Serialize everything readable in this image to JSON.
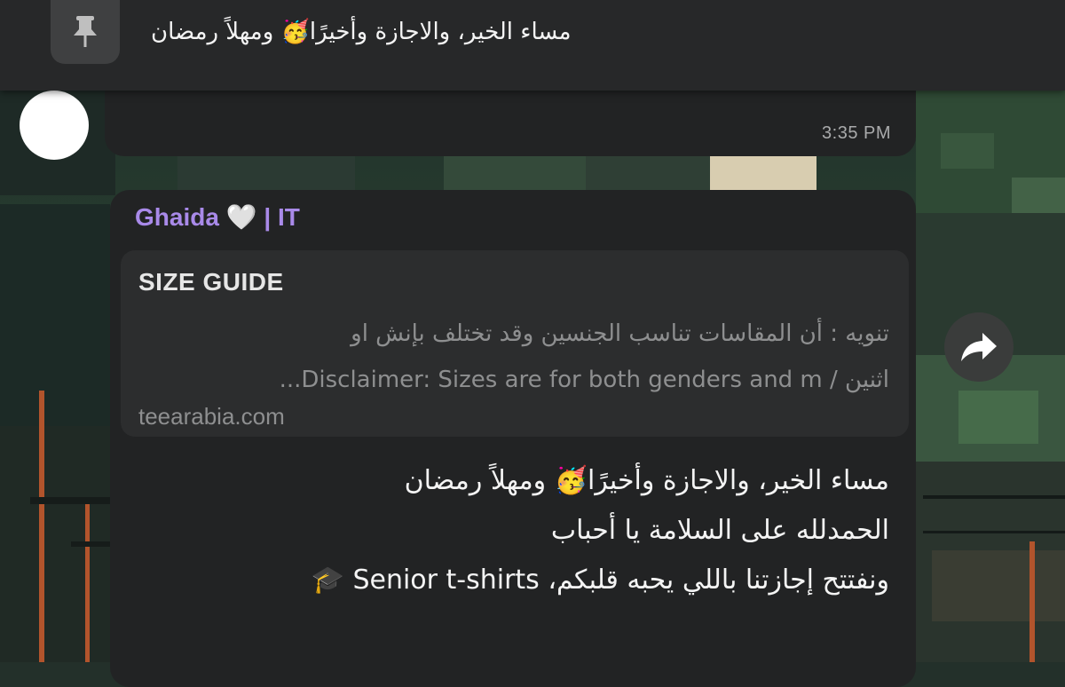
{
  "pinned": {
    "text": "مساء الخير، والاجازة وأخيرًا🥳 ومهلاً رمضان",
    "icon": "pin-icon"
  },
  "previous_message": {
    "time": "3:35 PM"
  },
  "message": {
    "sender": "Ghaida 🤍 | IT",
    "link_preview": {
      "title": "SIZE GUIDE",
      "desc_line1": "تنويه :  أن المقاسات تناسب الجنسين وقد تختلف بإنش او",
      "desc_line2": "اثنين  / Disclaimer: Sizes are for both genders and m...",
      "site": "teearabia.com"
    },
    "lines": [
      "مساء الخير، والاجازة وأخيرًا🥳 ومهلاً رمضان",
      "الحمدلله على السلامة يا أحباب",
      "ونفتتح إجازتنا باللي يحبه قلبكم، Senior t-shirts 🎓"
    ]
  },
  "forward_icon": "forward-arrow-icon",
  "colors": {
    "sender": "#a98ae9",
    "bubble": "#222324",
    "preview": "#2c2d2e",
    "pin_bar": "#272829"
  }
}
